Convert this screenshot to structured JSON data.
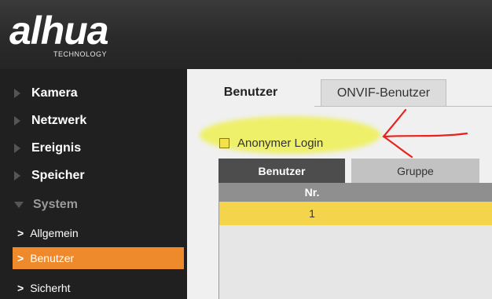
{
  "brand": {
    "logo": "alhua",
    "subtitle": "TECHNOLOGY"
  },
  "nav": {
    "items": [
      {
        "label": "Kamera"
      },
      {
        "label": "Netzwerk"
      },
      {
        "label": "Ereignis"
      },
      {
        "label": "Speicher"
      },
      {
        "label": "System"
      }
    ],
    "subitems": [
      {
        "label": "Allgemein"
      },
      {
        "label": "Benutzer",
        "active": true
      },
      {
        "label": "Sicherht"
      }
    ]
  },
  "tabs": [
    {
      "label": "Benutzer",
      "active": true
    },
    {
      "label": "ONVIF-Benutzer"
    }
  ],
  "anonymous_login": {
    "label": "Anonymer Login",
    "checked": false
  },
  "subtabs": [
    {
      "label": "Benutzer",
      "active": true
    },
    {
      "label": "Gruppe"
    }
  ],
  "table": {
    "columns": [
      "Nr."
    ],
    "rows": [
      [
        "1"
      ]
    ]
  },
  "colors": {
    "active_orange": "#ee8a2b",
    "selected_row": "#f3d44b",
    "highlight_yellow": "#eef06a",
    "annotation_red": "#e8231b"
  }
}
